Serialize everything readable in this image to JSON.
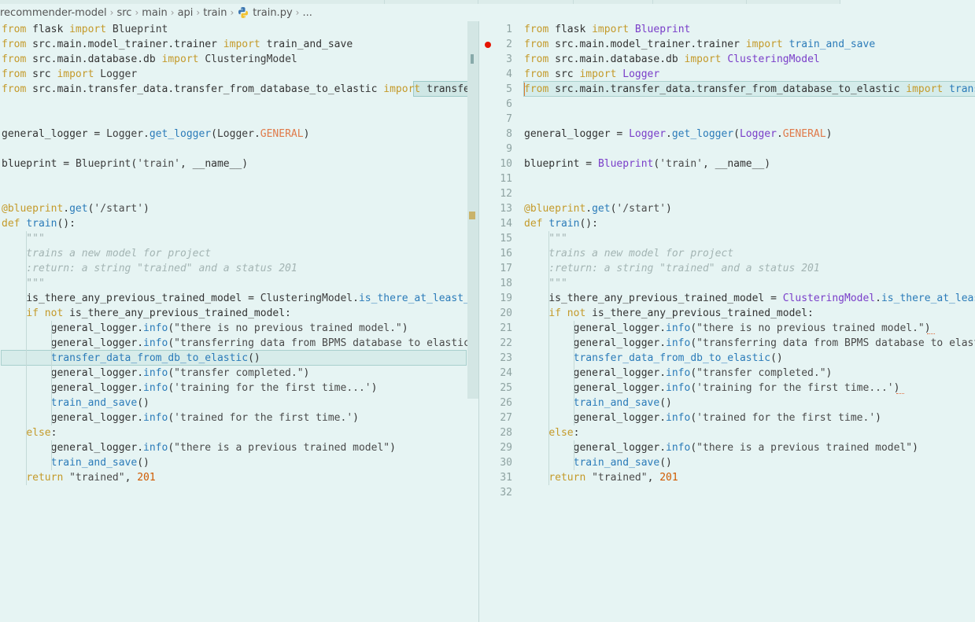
{
  "breadcrumb": {
    "items": [
      "recommender-model",
      "src",
      "main",
      "api",
      "train",
      "train.py",
      "..."
    ]
  },
  "code_lines": [
    "from flask import Blueprint",
    "from src.main.model_trainer.trainer import train_and_save",
    "from src.main.database.db import ClusteringModel",
    "from src import Logger",
    "from src.main.transfer_data.transfer_from_database_to_elastic import transfer_data_from_db_to_elastic",
    "",
    "",
    "general_logger = Logger.get_logger(Logger.GENERAL)",
    "",
    "blueprint = Blueprint('train', __name__)",
    "",
    "",
    "@blueprint.get('/start')",
    "def train():",
    "    \"\"\"",
    "    trains a new model for project",
    "    :return: a string \"trained\" and a status 201",
    "    \"\"\"",
    "    is_there_any_previous_trained_model = ClusteringModel.is_there_at_least_one_model()",
    "    if not is_there_any_previous_trained_model:",
    "        general_logger.info(\"there is no previous trained model.\")",
    "        general_logger.info(\"transferring data from BPMS database to elasticsearch\")",
    "        transfer_data_from_db_to_elastic()",
    "        general_logger.info(\"transfer completed.\")",
    "        general_logger.info('training for the first time...')",
    "        train_and_save()",
    "        general_logger.info('trained for the first time.')",
    "    else:",
    "        general_logger.info(\"there is a previous trained model\")",
    "        train_and_save()",
    "    return \"trained\", 201",
    ""
  ],
  "line_numbers": [
    "1",
    "2",
    "3",
    "4",
    "5",
    "6",
    "7",
    "8",
    "9",
    "10",
    "11",
    "12",
    "13",
    "14",
    "15",
    "16",
    "17",
    "18",
    "19",
    "20",
    "21",
    "22",
    "23",
    "24",
    "25",
    "26",
    "27",
    "28",
    "29",
    "30",
    "31",
    "32"
  ],
  "breakpoint_line": 2,
  "colors": {
    "background": "#e6f4f3",
    "keyword": "#c49a2a",
    "function": "#2b7bb9",
    "class_right": "#7a3ec9",
    "comment": "#a3b4b3",
    "constant": "#e07a4a",
    "number": "#d05a00",
    "breakpoint": "#e51400"
  },
  "icons": {
    "python_file": "python-icon",
    "breakpoint": "breakpoint-dot-icon"
  }
}
